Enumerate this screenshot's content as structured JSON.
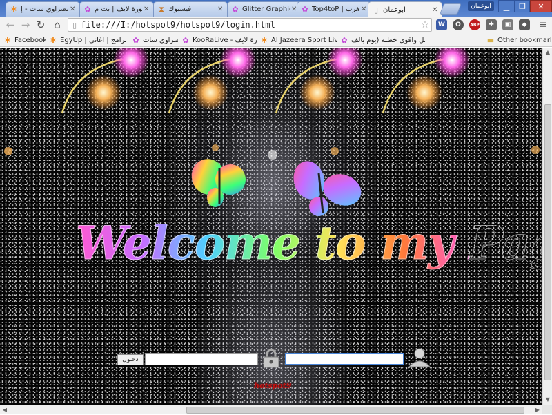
{
  "tabs": [
    {
      "title": "مصراوي سات - إ",
      "icon": "asterisk-icon",
      "active": false
    },
    {
      "title": "كورة لايف | بث م",
      "icon": "colorful-wheel-icon",
      "active": false
    },
    {
      "title": "فيسبوك",
      "icon": "hourglass-icon",
      "active": false
    },
    {
      "title": "Glitter Graphic",
      "icon": "colorful-wheel-icon",
      "active": false
    },
    {
      "title": "Top4toP | مغرب",
      "icon": "colorful-wheel-icon",
      "active": false
    },
    {
      "title": "ابوعمان",
      "icon": "page-icon",
      "active": true
    }
  ],
  "window": {
    "profile_label": "ابوعمان"
  },
  "toolbar": {
    "url": "file:///I:/hotspot9/hotspot9/login.html",
    "extensions": [
      {
        "name": "w-extension-icon",
        "label": "W",
        "color": "#3b5ca8"
      },
      {
        "name": "opera-extension-icon",
        "label": "O",
        "color": "#555555"
      },
      {
        "name": "adblock-icon",
        "label": "ABP",
        "color": "#c0181b"
      },
      {
        "name": "puzzle-extension-icon",
        "label": "✚",
        "color": "#6a6a6a"
      },
      {
        "name": "save-extension-icon",
        "label": "▣",
        "color": "#7a7a7a"
      },
      {
        "name": "cube-extension-icon",
        "label": "◆",
        "color": "#5a5a5a"
      }
    ]
  },
  "bookmarks": [
    {
      "label": "Facebook",
      "icon": "asterisk-icon"
    },
    {
      "label": "EgyUp | برامج | اغاني | ...",
      "icon": "asterisk-icon"
    },
    {
      "label": "مصراوي سات",
      "icon": "colorful-wheel-icon"
    },
    {
      "label": "KooRaLive - كورة لايف",
      "icon": "colorful-wheel-icon"
    },
    {
      "label": "Al Jazeera Sport Live S",
      "icon": "asterisk-icon"
    },
    {
      "label": "اجمل واقوى خطبة (يوم بالف",
      "icon": "colorful-wheel-icon"
    }
  ],
  "other_bookmarks": "Other bookmarks",
  "page": {
    "welcome_text": "Welcome to my Page...",
    "login_button_label": "دخـول",
    "password_value": "",
    "username_value": "",
    "footer_logo": "hotspot9"
  },
  "colors": {
    "tab_strip": "#3f6fc0",
    "page_background": "#050505",
    "focus_border": "#4a86d8",
    "footer_logo": "#c01010"
  }
}
